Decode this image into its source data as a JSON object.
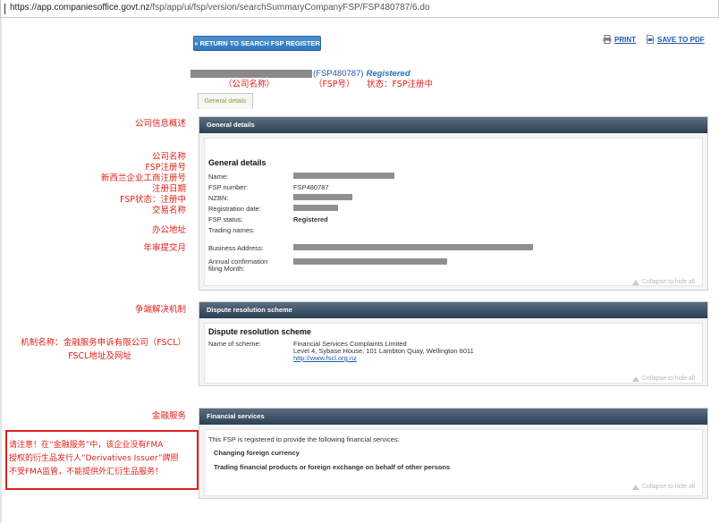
{
  "browser": {
    "url_host": "https://app.companiesoffice.govt.nz",
    "url_path": "/fsp/app/ui/fsp/version/searchSummaryCompanyFSP/FSP480787/6.do"
  },
  "toolbar": {
    "return_label": "« RETURN TO SEARCH FSP REGISTER",
    "print_label": "PRINT",
    "pdf_label": "SAVE TO PDF"
  },
  "header": {
    "fsp_number": "(FSP480787)",
    "status": "Registered"
  },
  "annotations": {
    "company_name": "（公司名称）",
    "fsp_no": "（FSP号）",
    "status": "状态：FSP注册中",
    "overview": "公司信息概述",
    "labels_block": [
      "公司名称",
      "FSP注册号",
      "新西兰企业工商注册号",
      "注册日期",
      "FSP状态：注册中",
      "交易名称"
    ],
    "address": "办公地址",
    "annual": "年审提交月",
    "dispute": "争端解决机制",
    "scheme_line1": "机制名称：金融服务申诉有限公司（FSCL）",
    "scheme_line2": "FSCL地址及网址",
    "financial": "金融服务",
    "warning_lines": [
      "请注意！在“金融服务”中，该企业没有FMA",
      "授权的衍生品发行人“Derivatives Issuer”牌照",
      "不受FMA监管，不能提供外汇衍生品服务！"
    ]
  },
  "tabs": {
    "general": "General details"
  },
  "general": {
    "header": "General details",
    "title": "General details",
    "labels": {
      "name": "Name:",
      "fsp_number": "FSP number:",
      "nzbn": "NZBN:",
      "reg_date": "Registration date:",
      "fsp_status": "FSP status:",
      "trading": "Trading names:",
      "business_address": "Business Address:",
      "annual_1": "Annual confirmation",
      "annual_2": "filing Month:"
    },
    "values": {
      "fsp_number": "FSP480787",
      "fsp_status": "Registered"
    },
    "collapse": "Collapse to hide all"
  },
  "dispute": {
    "header": "Dispute resolution scheme",
    "title": "Dispute resolution scheme",
    "name_label": "Name of scheme:",
    "scheme_name": "Financial Services Complaints Limited",
    "scheme_address": "Level 4, Sybase House, 101 Lambton Quay, Wellington 6011",
    "scheme_url": "http://www.fscl.org.nz",
    "collapse": "Collapse to hide all"
  },
  "financial": {
    "header": "Financial services",
    "intro": "This FSP is registered to provide the following financial services:",
    "services": [
      "Changing foreign currency",
      "Trading financial products or foreign exchange on behalf of other persons"
    ],
    "collapse": "Collapse to hide all"
  },
  "colors": {
    "annotation_red": "#e0201a",
    "link_blue": "#1f5aa8",
    "panel_header": "#2c3e52",
    "button_blue": "#2f77bf"
  }
}
